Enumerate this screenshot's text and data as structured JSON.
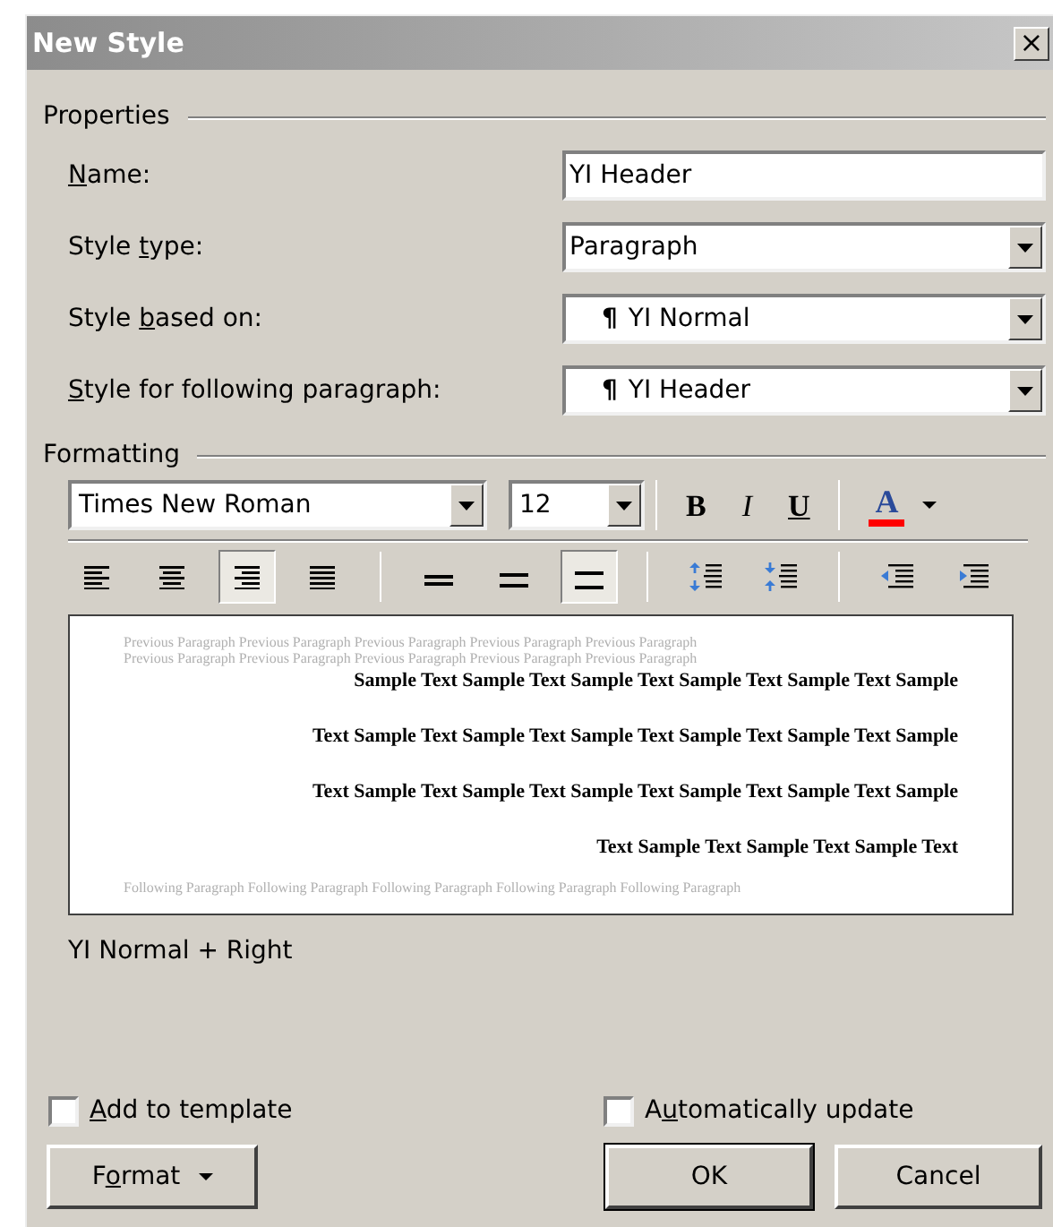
{
  "window": {
    "title": "New Style",
    "close": "×"
  },
  "properties": {
    "heading": "Properties",
    "fields": [
      {
        "kind": "text",
        "label": {
          "key": "N",
          "after": "ame:"
        },
        "value": "YI Header"
      },
      {
        "kind": "dropdown",
        "label": {
          "before": "Style ",
          "key": "t",
          "after": "ype:"
        },
        "value": "Paragraph"
      },
      {
        "kind": "dropdown",
        "label": {
          "before": "Style ",
          "key": "b",
          "after": "ased on:"
        },
        "mark": "¶",
        "value": "YI Normal"
      },
      {
        "kind": "dropdown",
        "label": {
          "key": "S",
          "after": "tyle for following paragraph:"
        },
        "mark": "¶",
        "value": "YI Header"
      }
    ]
  },
  "formatting": {
    "heading": "Formatting",
    "font": "Times New Roman",
    "size": "12",
    "text_buttons": [
      {
        "kind": "bold",
        "label": "B"
      },
      {
        "kind": "italic",
        "label": "I"
      },
      {
        "kind": "underline",
        "label": "U"
      },
      {
        "kind": "color",
        "label": "A",
        "color": "#ff0000"
      }
    ],
    "alignment": [
      {
        "kind": "left",
        "selected": false
      },
      {
        "kind": "center",
        "selected": false
      },
      {
        "kind": "right",
        "selected": true
      },
      {
        "kind": "justify",
        "selected": false
      }
    ],
    "line_spacing": [
      {
        "kind": "single",
        "selected": false
      },
      {
        "kind": "one-half",
        "selected": false
      },
      {
        "kind": "double",
        "selected": true
      }
    ],
    "paragraph_spacing": [
      {
        "kind": "more"
      },
      {
        "kind": "less"
      }
    ],
    "indent": [
      {
        "kind": "decrease"
      },
      {
        "kind": "increase"
      }
    ],
    "preview": {
      "previous": [
        "Previous Paragraph Previous Paragraph Previous Paragraph Previous Paragraph Previous Paragraph",
        "Previous Paragraph Previous Paragraph Previous Paragraph Previous Paragraph Previous Paragraph"
      ],
      "sample": [
        "Sample Text Sample Text Sample Text Sample Text Sample Text Sample",
        "Text Sample Text Sample Text Sample Text Sample Text Sample Text Sample",
        "Text Sample Text Sample Text Sample Text Sample Text Sample Text Sample",
        "Text Sample Text Sample Text Sample Text"
      ],
      "following": [
        "Following Paragraph Following Paragraph Following Paragraph Following Paragraph Following Paragraph"
      ]
    },
    "description": "YI Normal + Right"
  },
  "options": [
    {
      "label": {
        "key": "A",
        "after": "dd to template"
      },
      "checked": false
    },
    {
      "label": {
        "before": "A",
        "key": "u",
        "after": "tomatically update"
      },
      "checked": false
    }
  ],
  "buttons": [
    {
      "kind": "menu",
      "label": {
        "before": "F",
        "key": "o",
        "after": "rmat"
      }
    },
    {
      "kind": "default",
      "label": {
        "before": "OK"
      }
    },
    {
      "kind": "plain",
      "label": {
        "before": "Cancel"
      }
    }
  ]
}
